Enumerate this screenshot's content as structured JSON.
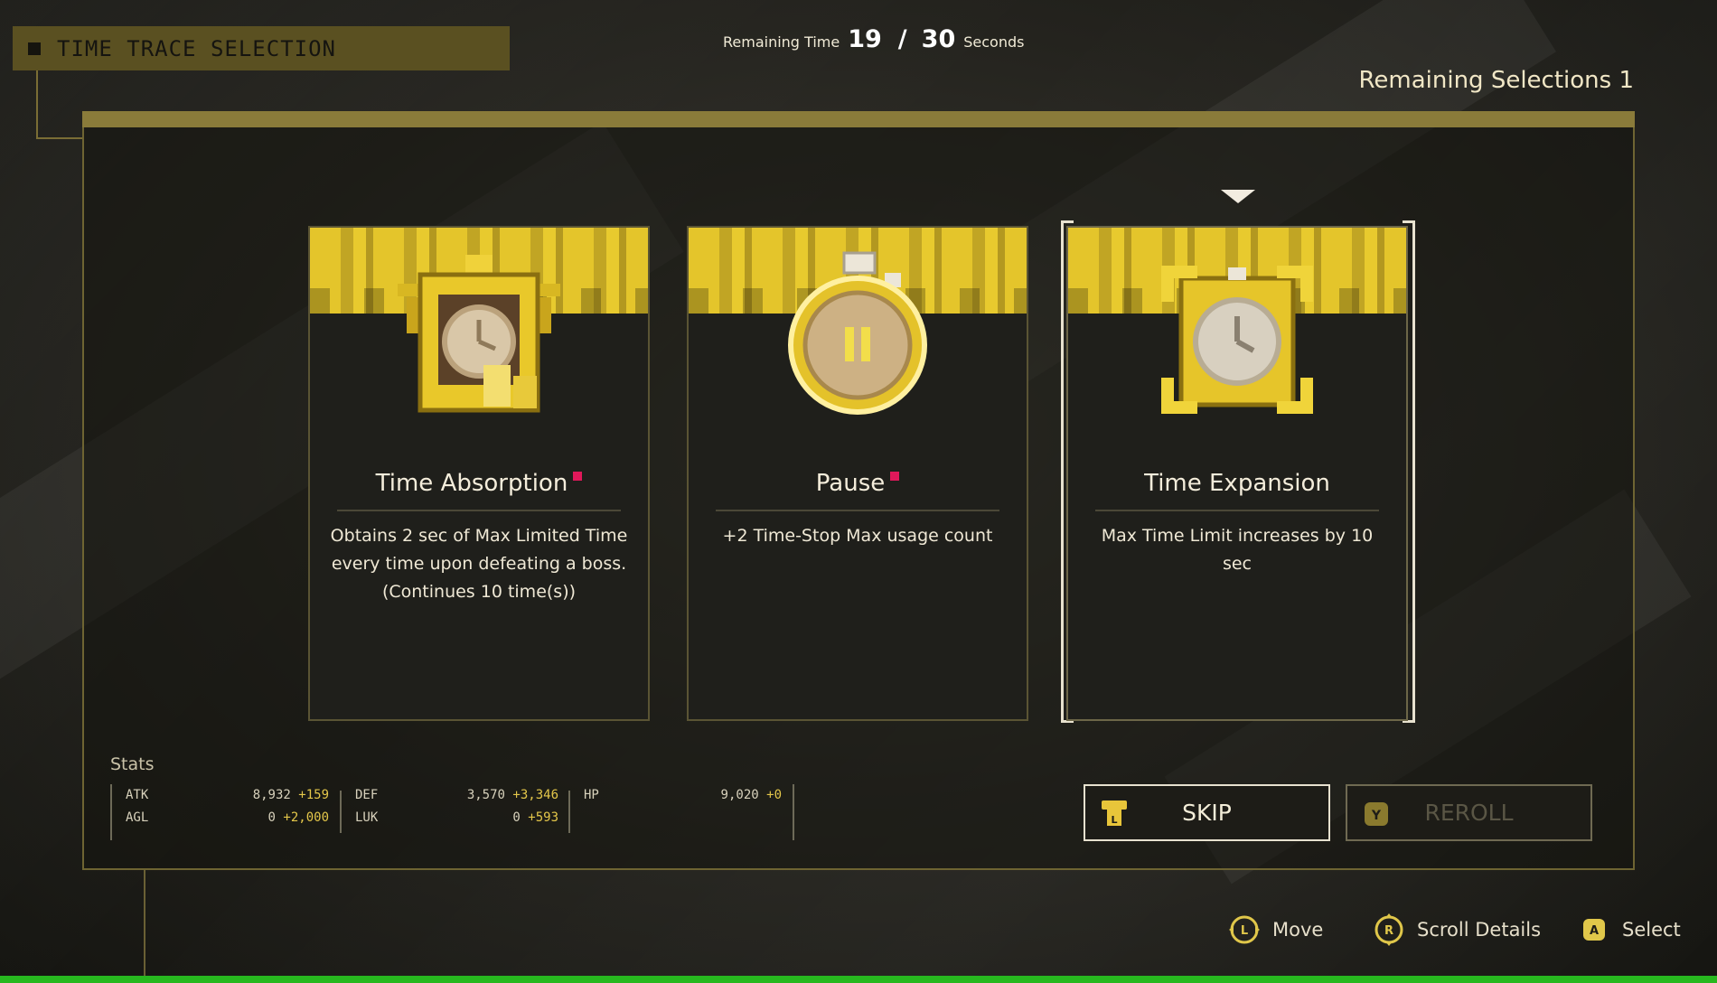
{
  "header": {
    "title": "TIME TRACE SELECTION",
    "timer_label": "Remaining Time",
    "timer_current": "19",
    "timer_separator": "/",
    "timer_total": "30",
    "timer_unit": "Seconds",
    "remaining_selections": "Remaining Selections 1"
  },
  "cards": [
    {
      "name": "Time Absorption",
      "description": "Obtains 2 sec of Max Limited Time every time upon defeating a boss. (Continues 10 time(s))",
      "icon": "clock-trophy-icon",
      "has_marker": true
    },
    {
      "name": "Pause",
      "description": "+2 Time-Stop Max usage count",
      "icon": "pause-stopwatch-icon",
      "has_marker": true
    },
    {
      "name": "Time Expansion",
      "description": "Max Time Limit increases by 10 sec",
      "icon": "expand-clock-icon",
      "has_marker": false,
      "selected": true
    }
  ],
  "stats": {
    "label": "Stats",
    "rows": [
      [
        {
          "name": "ATK",
          "value": "8,932",
          "bonus": "+159"
        },
        {
          "name": "DEF",
          "value": "3,570",
          "bonus": "+3,346"
        },
        {
          "name": "HP",
          "value": "9,020",
          "bonus": "+0"
        }
      ],
      [
        {
          "name": "AGL",
          "value": "0",
          "bonus": "+2,000"
        },
        {
          "name": "LUK",
          "value": "0",
          "bonus": "+593"
        }
      ]
    ]
  },
  "buttons": {
    "skip": {
      "label": "SKIP",
      "icon": "l-button-icon"
    },
    "reroll": {
      "label": "REROLL",
      "icon": "y-button-icon",
      "enabled": false
    }
  },
  "hints": [
    {
      "icon": "l-stick-icon",
      "label": "Move"
    },
    {
      "icon": "r-stick-icon",
      "label": "Scroll Details"
    },
    {
      "icon": "a-button-icon",
      "label": "Select"
    }
  ],
  "colors": {
    "gold": "#e4c52b",
    "title_bar": "#5a5021",
    "marker": "#e0185a",
    "bonus": "#e4c74a",
    "bottom_bar": "#27b81f"
  }
}
